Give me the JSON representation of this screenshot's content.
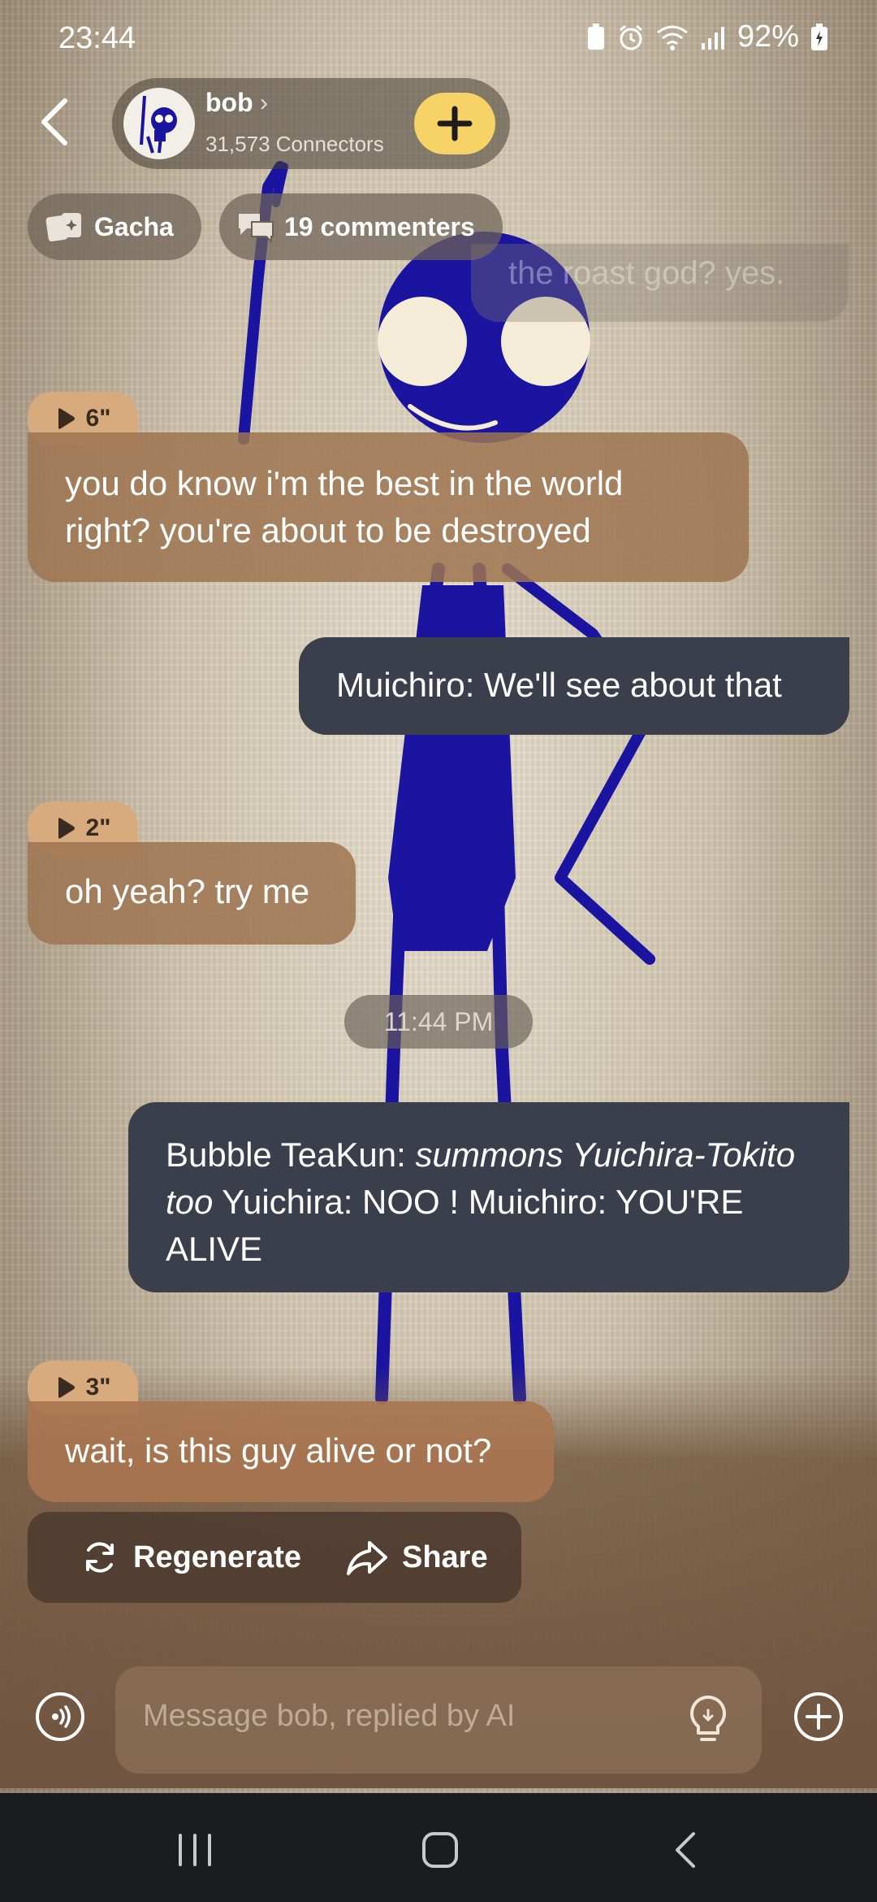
{
  "status_bar": {
    "time": "23:44",
    "battery": "92%"
  },
  "header": {
    "name": "bob",
    "connectors": "31,573 Connectors",
    "plus_label": "+"
  },
  "chips": {
    "gacha": "Gacha",
    "commenters": "19 commenters"
  },
  "ghost_message": "the roast god? yes.",
  "messages": [
    {
      "role": "bot",
      "duration": "6\"",
      "text": "you do know i'm the best in the world right? you're about to be destroyed"
    },
    {
      "role": "user",
      "text": "Muichiro: We'll see about that"
    },
    {
      "role": "bot",
      "duration": "2\"",
      "text": "oh yeah? try me"
    },
    {
      "role": "user",
      "parts": {
        "a": "Bubble TeaKun: ",
        "b": "summons Yuichira-Tokito too",
        "c": " Yuichira: NOO ! Muichiro: YOU'RE ALIVE"
      }
    },
    {
      "role": "bot",
      "duration": "3\"",
      "text": "wait, is this guy alive or not?"
    }
  ],
  "timestamp": "11:44 PM",
  "actions": {
    "regenerate": "Regenerate",
    "share": "Share"
  },
  "composer": {
    "placeholder": "Message bob, replied by AI"
  },
  "colors": {
    "accent": "#f7d367",
    "bot_bubble": "#9e7450",
    "user_bubble": "#3b3f4c",
    "stick_figure": "#1a14a0"
  }
}
